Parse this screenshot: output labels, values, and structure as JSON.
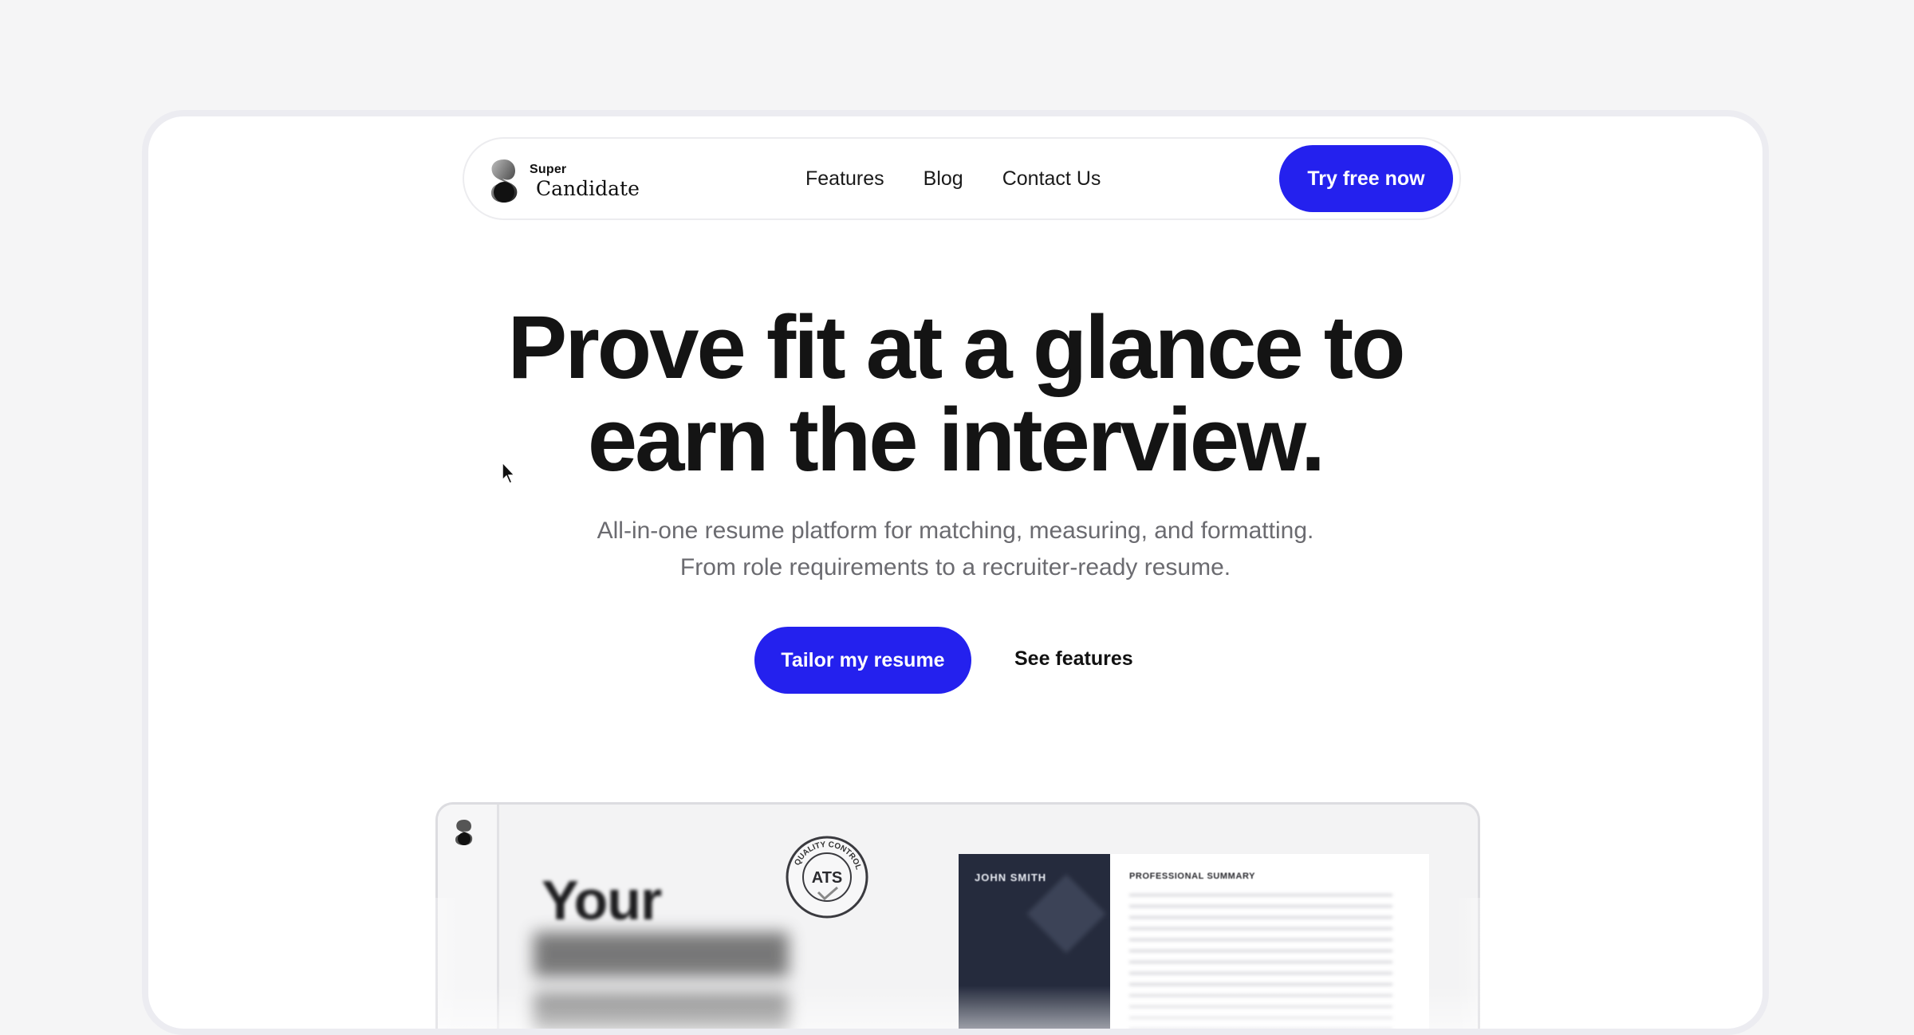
{
  "nav": {
    "logo_super": "Super",
    "logo_candidate": "Candidate",
    "links": [
      {
        "label": "Features"
      },
      {
        "label": "Blog"
      },
      {
        "label": "Contact Us"
      }
    ],
    "cta_label": "Try free now"
  },
  "hero": {
    "title_line1": "Prove fit at a glance to",
    "title_line2": "earn the interview.",
    "subtitle_line1": "All-in-one resume platform for matching, measuring, and formatting.",
    "subtitle_line2": "From role requirements to a recruiter-ready resume.",
    "primary_cta": "Tailor my resume",
    "secondary_cta": "See features"
  },
  "preview": {
    "headline": "Your",
    "badge_text": "ATS",
    "badge_ring_text": "QUALITY CONTROL",
    "resume_name": "JOHN SMITH",
    "resume_section": "PROFESSIONAL SUMMARY"
  },
  "colors": {
    "accent": "#2421ee",
    "background": "#f5f5f6",
    "resume_dark": "#252b3d"
  }
}
